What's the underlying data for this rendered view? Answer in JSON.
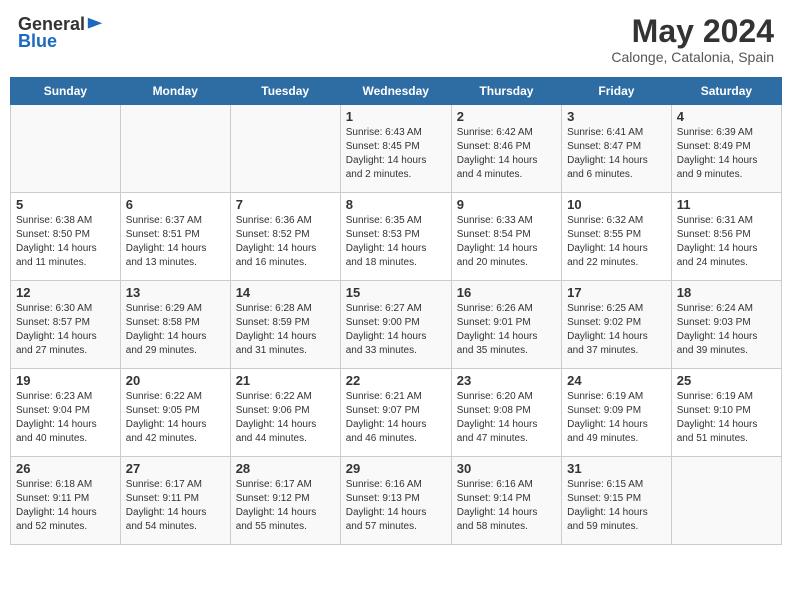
{
  "header": {
    "logo_general": "General",
    "logo_blue": "Blue",
    "month_year": "May 2024",
    "location": "Calonge, Catalonia, Spain"
  },
  "days_of_week": [
    "Sunday",
    "Monday",
    "Tuesday",
    "Wednesday",
    "Thursday",
    "Friday",
    "Saturday"
  ],
  "weeks": [
    [
      {
        "day": "",
        "info": ""
      },
      {
        "day": "",
        "info": ""
      },
      {
        "day": "",
        "info": ""
      },
      {
        "day": "1",
        "info": "Sunrise: 6:43 AM\nSunset: 8:45 PM\nDaylight: 14 hours\nand 2 minutes."
      },
      {
        "day": "2",
        "info": "Sunrise: 6:42 AM\nSunset: 8:46 PM\nDaylight: 14 hours\nand 4 minutes."
      },
      {
        "day": "3",
        "info": "Sunrise: 6:41 AM\nSunset: 8:47 PM\nDaylight: 14 hours\nand 6 minutes."
      },
      {
        "day": "4",
        "info": "Sunrise: 6:39 AM\nSunset: 8:49 PM\nDaylight: 14 hours\nand 9 minutes."
      }
    ],
    [
      {
        "day": "5",
        "info": "Sunrise: 6:38 AM\nSunset: 8:50 PM\nDaylight: 14 hours\nand 11 minutes."
      },
      {
        "day": "6",
        "info": "Sunrise: 6:37 AM\nSunset: 8:51 PM\nDaylight: 14 hours\nand 13 minutes."
      },
      {
        "day": "7",
        "info": "Sunrise: 6:36 AM\nSunset: 8:52 PM\nDaylight: 14 hours\nand 16 minutes."
      },
      {
        "day": "8",
        "info": "Sunrise: 6:35 AM\nSunset: 8:53 PM\nDaylight: 14 hours\nand 18 minutes."
      },
      {
        "day": "9",
        "info": "Sunrise: 6:33 AM\nSunset: 8:54 PM\nDaylight: 14 hours\nand 20 minutes."
      },
      {
        "day": "10",
        "info": "Sunrise: 6:32 AM\nSunset: 8:55 PM\nDaylight: 14 hours\nand 22 minutes."
      },
      {
        "day": "11",
        "info": "Sunrise: 6:31 AM\nSunset: 8:56 PM\nDaylight: 14 hours\nand 24 minutes."
      }
    ],
    [
      {
        "day": "12",
        "info": "Sunrise: 6:30 AM\nSunset: 8:57 PM\nDaylight: 14 hours\nand 27 minutes."
      },
      {
        "day": "13",
        "info": "Sunrise: 6:29 AM\nSunset: 8:58 PM\nDaylight: 14 hours\nand 29 minutes."
      },
      {
        "day": "14",
        "info": "Sunrise: 6:28 AM\nSunset: 8:59 PM\nDaylight: 14 hours\nand 31 minutes."
      },
      {
        "day": "15",
        "info": "Sunrise: 6:27 AM\nSunset: 9:00 PM\nDaylight: 14 hours\nand 33 minutes."
      },
      {
        "day": "16",
        "info": "Sunrise: 6:26 AM\nSunset: 9:01 PM\nDaylight: 14 hours\nand 35 minutes."
      },
      {
        "day": "17",
        "info": "Sunrise: 6:25 AM\nSunset: 9:02 PM\nDaylight: 14 hours\nand 37 minutes."
      },
      {
        "day": "18",
        "info": "Sunrise: 6:24 AM\nSunset: 9:03 PM\nDaylight: 14 hours\nand 39 minutes."
      }
    ],
    [
      {
        "day": "19",
        "info": "Sunrise: 6:23 AM\nSunset: 9:04 PM\nDaylight: 14 hours\nand 40 minutes."
      },
      {
        "day": "20",
        "info": "Sunrise: 6:22 AM\nSunset: 9:05 PM\nDaylight: 14 hours\nand 42 minutes."
      },
      {
        "day": "21",
        "info": "Sunrise: 6:22 AM\nSunset: 9:06 PM\nDaylight: 14 hours\nand 44 minutes."
      },
      {
        "day": "22",
        "info": "Sunrise: 6:21 AM\nSunset: 9:07 PM\nDaylight: 14 hours\nand 46 minutes."
      },
      {
        "day": "23",
        "info": "Sunrise: 6:20 AM\nSunset: 9:08 PM\nDaylight: 14 hours\nand 47 minutes."
      },
      {
        "day": "24",
        "info": "Sunrise: 6:19 AM\nSunset: 9:09 PM\nDaylight: 14 hours\nand 49 minutes."
      },
      {
        "day": "25",
        "info": "Sunrise: 6:19 AM\nSunset: 9:10 PM\nDaylight: 14 hours\nand 51 minutes."
      }
    ],
    [
      {
        "day": "26",
        "info": "Sunrise: 6:18 AM\nSunset: 9:11 PM\nDaylight: 14 hours\nand 52 minutes."
      },
      {
        "day": "27",
        "info": "Sunrise: 6:17 AM\nSunset: 9:11 PM\nDaylight: 14 hours\nand 54 minutes."
      },
      {
        "day": "28",
        "info": "Sunrise: 6:17 AM\nSunset: 9:12 PM\nDaylight: 14 hours\nand 55 minutes."
      },
      {
        "day": "29",
        "info": "Sunrise: 6:16 AM\nSunset: 9:13 PM\nDaylight: 14 hours\nand 57 minutes."
      },
      {
        "day": "30",
        "info": "Sunrise: 6:16 AM\nSunset: 9:14 PM\nDaylight: 14 hours\nand 58 minutes."
      },
      {
        "day": "31",
        "info": "Sunrise: 6:15 AM\nSunset: 9:15 PM\nDaylight: 14 hours\nand 59 minutes."
      },
      {
        "day": "",
        "info": ""
      }
    ]
  ]
}
